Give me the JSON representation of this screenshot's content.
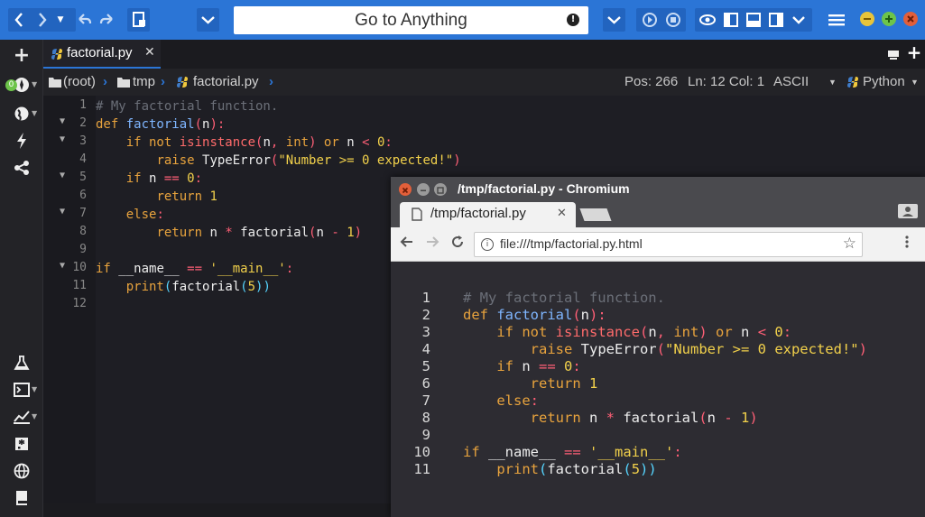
{
  "toolbar": {
    "goto_label": "Go to Anything",
    "warn_glyph": "!",
    "back_icon": "chevron-left-icon",
    "forward_icon": "chevron-right-icon"
  },
  "sidebar": {
    "badge": "0"
  },
  "tab": {
    "name": "factorial.py",
    "close": "✕"
  },
  "breadcrumb": {
    "root": "(root)",
    "folder": "tmp",
    "file": "factorial.py"
  },
  "status": {
    "pos": "Pos: 266",
    "line_col": "Ln: 12 Col: 1",
    "encoding": "ASCII",
    "language": "Python"
  },
  "editor": {
    "line_numbers": [
      "1",
      "2",
      "3",
      "4",
      "5",
      "6",
      "7",
      "8",
      "9",
      "10",
      "11",
      "12"
    ]
  },
  "chromium": {
    "title": "/tmp/factorial.py - Chromium",
    "tab_title": "/tmp/factorial.py",
    "tab_close": "✕",
    "url": "file:///tmp/factorial.py.html",
    "line_numbers": [
      "1",
      "2",
      "3",
      "4",
      "5",
      "6",
      "7",
      "8",
      "9",
      "10",
      "11"
    ]
  },
  "colors": {
    "accent": "#2b75d6",
    "comment": "#6b6f78",
    "keyword": "#e8a33d",
    "function": "#7fb6ff",
    "builtin": "#ff6b6b",
    "string": "#f2d14b",
    "operator": "#ff5f76"
  }
}
